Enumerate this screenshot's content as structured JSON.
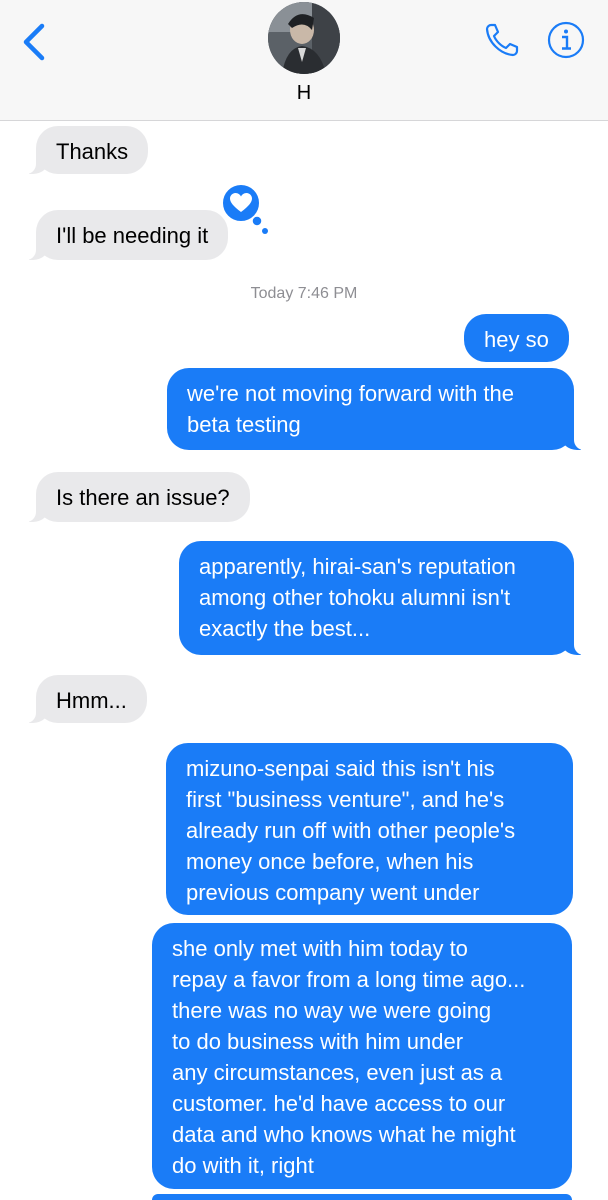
{
  "header": {
    "contact_name": "H",
    "icons": [
      "chevron-left-icon",
      "avatar",
      "phone-icon",
      "info-icon"
    ],
    "accent_color": "#1a7cf7"
  },
  "timestamp": {
    "day": "Today",
    "time": "7:46 PM"
  },
  "messages": [
    {
      "from": "them",
      "lines": [
        "Thanks"
      ]
    },
    {
      "from": "them",
      "lines": [
        "I'll be needing it"
      ],
      "reaction": "heart"
    },
    {
      "from": "me",
      "lines": [
        "hey so"
      ]
    },
    {
      "from": "me",
      "lines": [
        "we're not moving forward with the",
        "beta testing"
      ]
    },
    {
      "from": "them",
      "lines": [
        "Is there an issue?"
      ]
    },
    {
      "from": "me",
      "lines": [
        "apparently, hirai-san's reputation",
        "among other tohoku alumni isn't",
        "exactly the best..."
      ]
    },
    {
      "from": "them",
      "lines": [
        "Hmm..."
      ]
    },
    {
      "from": "me",
      "lines": [
        "mizuno-senpai said this isn't his",
        "first \"business venture\", and he's",
        "already run off with other people's",
        "money once before, when his",
        "previous company went under"
      ]
    },
    {
      "from": "me",
      "lines": [
        "she only met with him today to",
        "repay a favor from a long time ago...",
        "there was no way we were going",
        "to do business with him under",
        "any circumstances, even just as a",
        "customer. he'd have access to our",
        "data and who knows what he might",
        "do with it, right"
      ]
    }
  ]
}
